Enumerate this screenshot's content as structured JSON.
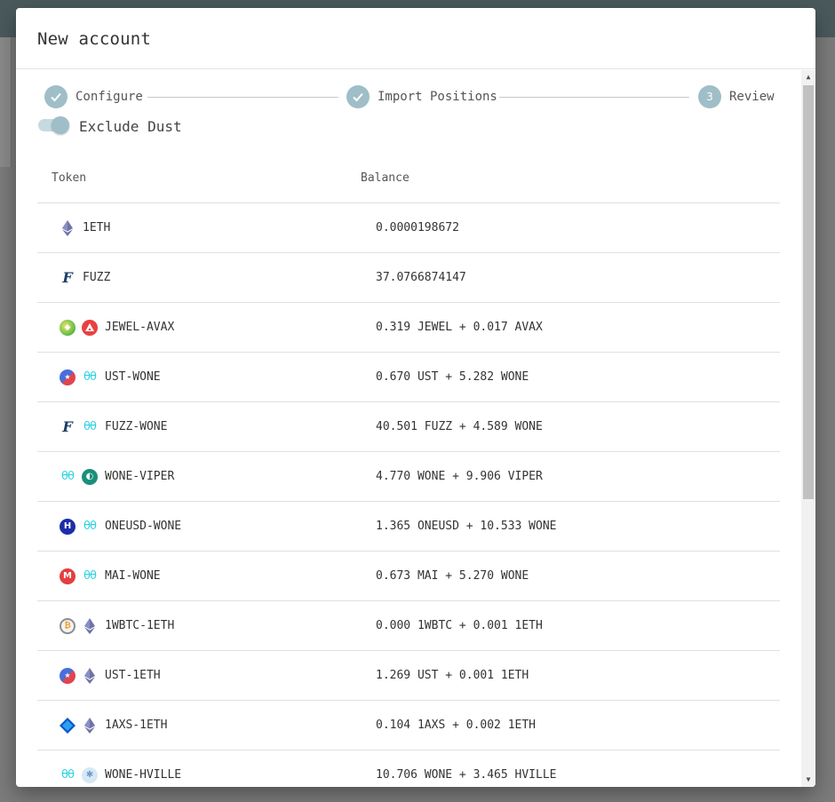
{
  "dialog": {
    "title": "New account"
  },
  "stepper": {
    "steps": [
      {
        "label": "Configure",
        "state": "completed",
        "icon": "check-icon"
      },
      {
        "label": "Import Positions",
        "state": "completed",
        "icon": "check-icon"
      },
      {
        "label": "Review",
        "state": "active",
        "number": "3"
      }
    ],
    "accent_color": "#9fbec7"
  },
  "exclude_dust": {
    "label": "Exclude Dust",
    "enabled": true
  },
  "table": {
    "headers": {
      "token": "Token",
      "balance": "Balance"
    },
    "rows": [
      {
        "token": "1ETH",
        "balance": "0.0000198672",
        "icons": [
          "eth-icon"
        ]
      },
      {
        "token": "FUZZ",
        "balance": "37.0766874147",
        "icons": [
          "fuzz-icon"
        ]
      },
      {
        "token": "JEWEL-AVAX",
        "balance": "0.319 JEWEL + 0.017 AVAX",
        "icons": [
          "jewel-icon",
          "avax-icon"
        ]
      },
      {
        "token": "UST-WONE",
        "balance": "0.670 UST + 5.282 WONE",
        "icons": [
          "ust-icon",
          "harmony-icon"
        ]
      },
      {
        "token": "FUZZ-WONE",
        "balance": "40.501 FUZZ + 4.589 WONE",
        "icons": [
          "fuzz-icon",
          "harmony-icon"
        ]
      },
      {
        "token": "WONE-VIPER",
        "balance": "4.770 WONE + 9.906 VIPER",
        "icons": [
          "harmony-icon",
          "viper-icon"
        ]
      },
      {
        "token": "ONEUSD-WONE",
        "balance": "1.365 ONEUSD + 10.533 WONE",
        "icons": [
          "oneusd-icon",
          "harmony-icon"
        ]
      },
      {
        "token": "MAI-WONE",
        "balance": "0.673 MAI + 5.270 WONE",
        "icons": [
          "mai-icon",
          "harmony-icon"
        ]
      },
      {
        "token": "1WBTC-1ETH",
        "balance": "0.000 1WBTC + 0.001 1ETH",
        "icons": [
          "btc-icon",
          "eth-icon"
        ]
      },
      {
        "token": "UST-1ETH",
        "balance": "1.269 UST + 0.001 1ETH",
        "icons": [
          "ust-icon",
          "eth-icon"
        ]
      },
      {
        "token": "1AXS-1ETH",
        "balance": "0.104 1AXS + 0.002 1ETH",
        "icons": [
          "axs-icon",
          "eth-icon"
        ]
      },
      {
        "token": "WONE-HVILLE",
        "balance": "10.706 WONE + 3.465 HVILLE",
        "icons": [
          "harmony-icon",
          "hville-icon"
        ]
      }
    ]
  }
}
